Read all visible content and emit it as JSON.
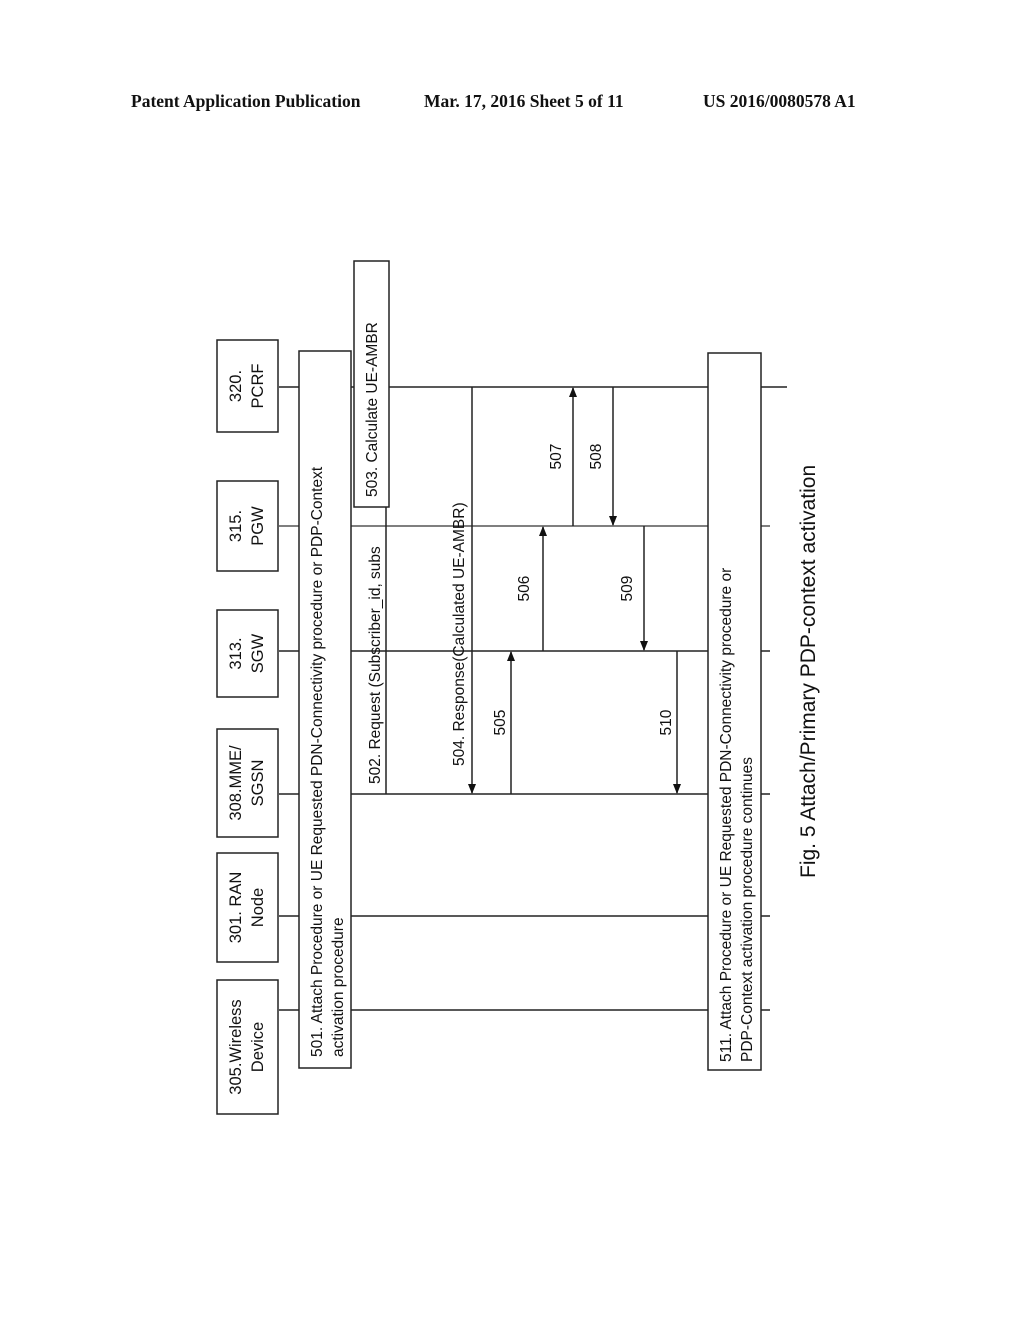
{
  "header": {
    "publication": "Patent Application Publication",
    "date_sheet": "Mar. 17, 2016  Sheet 5 of 11",
    "number": "US 2016/0080578 A1"
  },
  "figure": {
    "caption": "Fig. 5 Attach/Primary PDP-context activation",
    "orientation": "rotated 90° counter-clockwise",
    "entities": [
      {
        "id": "305",
        "line1": "305.Wireless",
        "line2": "Device"
      },
      {
        "id": "301",
        "line1": "301. RAN",
        "line2": "Node"
      },
      {
        "id": "308",
        "line1": "308.MME/",
        "line2": "SGSN"
      },
      {
        "id": "313",
        "line1": "313.",
        "line2": "SGW"
      },
      {
        "id": "315",
        "line1": "315.",
        "line2": "PGW"
      },
      {
        "id": "320",
        "line1": "320.",
        "line2": "PCRF"
      }
    ],
    "steps": [
      {
        "id": "501",
        "type": "box",
        "lines": [
          "501. Attach Procedure or UE Requested PDN-Connectivity procedure  or PDP-Context",
          "activation procedure"
        ]
      },
      {
        "id": "502",
        "type": "message",
        "from": "308",
        "to": "320",
        "label": "502. Request (Subscriber_id, subs"
      },
      {
        "id": "503",
        "type": "box",
        "lines": [
          "503. Calculate UE-AMBR"
        ]
      },
      {
        "id": "504",
        "type": "message",
        "from": "320",
        "to": "308",
        "label": "504. Response(Calculated UE-AMBR)"
      },
      {
        "id": "505",
        "type": "message",
        "from": "308",
        "to": "313",
        "label": "505"
      },
      {
        "id": "506",
        "type": "message",
        "from": "313",
        "to": "315",
        "label": "506"
      },
      {
        "id": "507",
        "type": "message",
        "from": "315",
        "to": "320",
        "label": "507"
      },
      {
        "id": "508",
        "type": "message",
        "from": "320",
        "to": "315",
        "label": "508"
      },
      {
        "id": "509",
        "type": "message",
        "from": "315",
        "to": "313",
        "label": "509"
      },
      {
        "id": "510",
        "type": "message",
        "from": "313",
        "to": "308",
        "label": "510"
      },
      {
        "id": "511",
        "type": "box",
        "lines": [
          "511. Attach Procedure or UE Requested PDN-Connectivity procedure or",
          "PDP-Context activation procedure continues"
        ]
      }
    ]
  }
}
